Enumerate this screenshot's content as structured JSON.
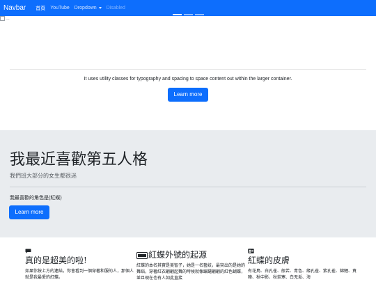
{
  "navbar": {
    "brand": "Navbar",
    "items": [
      {
        "label": "首頁",
        "state": "active"
      },
      {
        "label": "YouTube",
        "state": "normal"
      },
      {
        "label": "Dropdown",
        "state": "dropdown"
      },
      {
        "label": "Disabled",
        "state": "disabled"
      }
    ]
  },
  "carousel": {
    "broken_image_alt": "...",
    "indicator_count": 3,
    "active_indicator": 0
  },
  "hero": {
    "lead_text": "It uses utility classes for typography and spacing to space content out within the larger container.",
    "button_label": "Learn more"
  },
  "jumbotron": {
    "title": "我最近喜歡第五人格",
    "subtitle": "我們班大部分的女生都很迷",
    "description": "我最喜歡的角色是(紅蝶)",
    "button_label": "Learn more"
  },
  "columns": [
    {
      "icon": "chat-icon",
      "title": "真的是超美的啦!",
      "text": "如果你按上方的連結，你會看到一個穿著和服的人，那個人就是我最愛的紅蝶。"
    },
    {
      "icon": "credit-card-icon",
      "title": "紅蝶外號的起源",
      "text": "紅蝶的本名其實是美智子，她是一名藝妓，最突出的是她的舞蹈，穿著紅衣翩翩起舞的時候就像蹁躚翩翩的紅色蝴蝶，並且現在也有人如此直接"
    },
    {
      "icon": "person-card-icon",
      "title": "紅蝶的皮膚",
      "text": "有花鳥、白孔雀、般若、青色、緣孔雀、紫孔雀、錦鯉、貴陣、秋中影、秋荻寒、白无垢、海"
    }
  ],
  "colors": {
    "primary": "#0d6efd",
    "jumbotron_bg": "#e9ecef"
  }
}
